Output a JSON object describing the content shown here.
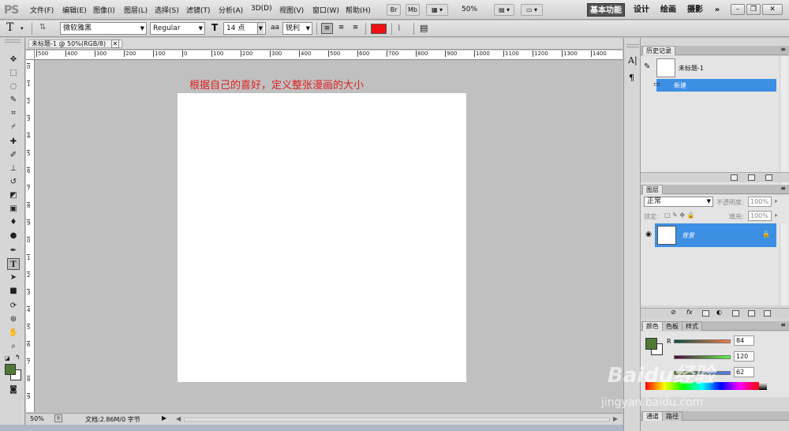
{
  "app": {
    "logo": "PS",
    "menu": [
      "文件(F)",
      "编辑(E)",
      "图像(I)",
      "图层(L)",
      "选择(S)",
      "滤镜(T)",
      "分析(A)",
      "3D(D)",
      "视图(V)",
      "窗口(W)",
      "帮助(H)"
    ],
    "bridge_btn": "Br",
    "minibridge_btn": "Mb",
    "zoom": "50%",
    "workspaces": [
      "基本功能",
      "设计",
      "绘画",
      "摄影"
    ],
    "more": "»"
  },
  "options": {
    "tool_glyph": "T",
    "font_family": "微软雅黑",
    "font_style": "Regular",
    "font_size": "14 点",
    "aa_label": "aa",
    "antialias": "锐利",
    "text_color": "#ee1111"
  },
  "document": {
    "tab_title": "未标题-1 @ 50%(RGB/8)",
    "annotation": "根据自己的喜好，定义整张漫画的大小",
    "ruler_labels": [
      "500",
      "400",
      "300",
      "200",
      "100",
      "0",
      "100",
      "200",
      "300",
      "400",
      "500",
      "600",
      "700",
      "800",
      "900",
      "1000",
      "1100",
      "1200",
      "1300",
      "1400"
    ],
    "vruler_labels": [
      "0",
      "1",
      "2",
      "3",
      "4",
      "5",
      "6",
      "7",
      "8",
      "9",
      "0",
      "1",
      "2",
      "3",
      "4",
      "5",
      "6",
      "7",
      "8",
      "9"
    ],
    "status_zoom": "50%",
    "status_doc": "文档:2.86M/0 字节"
  },
  "history": {
    "tab": "历史记录",
    "snapshot_label": "未标题-1",
    "steps": [
      "新建"
    ]
  },
  "layers": {
    "tab": "图层",
    "blend": "正常",
    "opacity_label": "不透明度:",
    "opacity": "100%",
    "lock_label": "锁定:",
    "fill_label": "填充:",
    "fill": "100%",
    "items": [
      {
        "name": "背景"
      }
    ]
  },
  "color": {
    "tabs": [
      "颜色",
      "色板",
      "样式"
    ],
    "r_label": "R",
    "r": "84",
    "g": "120",
    "b": "62",
    "fg_color": "#4e7a34"
  },
  "bottom_tabs": [
    "通道",
    "路径"
  ],
  "watermark": {
    "brand": "Baidu经验",
    "url": "jingyan.baidu.com"
  }
}
